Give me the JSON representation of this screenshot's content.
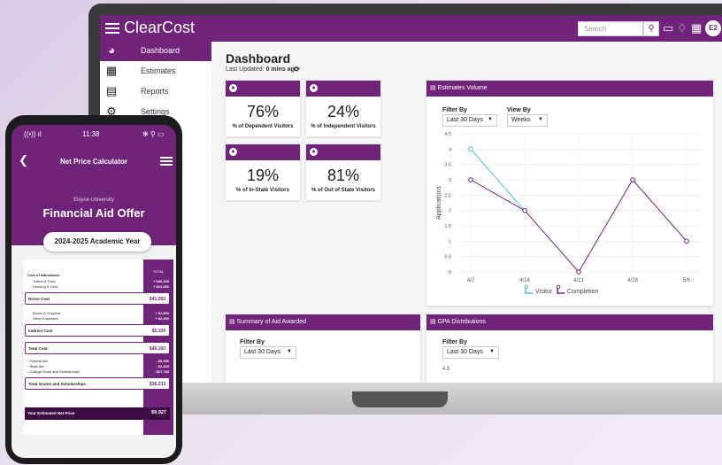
{
  "app": {
    "brand": "ClearCost",
    "search_placeholder": "Search",
    "avatar_initials": "E2"
  },
  "sidebar": {
    "items": [
      {
        "label": "Dashboard",
        "icon": "speedometer-icon",
        "active": true
      },
      {
        "label": "Estimates",
        "icon": "calculator-icon",
        "active": false
      },
      {
        "label": "Reports",
        "icon": "chart-icon",
        "active": false
      },
      {
        "label": "Settings",
        "icon": "gear-icon",
        "active": false
      }
    ]
  },
  "dashboard": {
    "title": "Dashboard",
    "updated_label": "Last Updated:",
    "updated_value": "0 mins ago",
    "stats": [
      {
        "value": "76%",
        "label": "% of Dependent Visitors"
      },
      {
        "value": "24%",
        "label": "% of Independent Visitors"
      },
      {
        "value": "19%",
        "label": "% of In-State Visitors"
      },
      {
        "value": "81%",
        "label": "% of Out of State Visitors"
      }
    ]
  },
  "estimates_volume": {
    "title": "Estimates Volume",
    "filter_label": "Filter By",
    "filter_value": "Last 30 Days",
    "view_label": "View By",
    "view_value": "Weeks"
  },
  "aid_summary": {
    "title": "Summary of Aid Awarded",
    "filter_label": "Filter By",
    "filter_value": "Last 30 Days"
  },
  "gpa": {
    "title": "GPA Distributions",
    "filter_label": "Filter By",
    "filter_value": "Last 30 Days",
    "first_tick": "4.5"
  },
  "chart_data": {
    "type": "line",
    "title": "",
    "xlabel": "",
    "ylabel": "Applications",
    "categories": [
      "4/7",
      "4/14",
      "4/21",
      "4/28",
      "5/5"
    ],
    "ylim": [
      0,
      4.5
    ],
    "yticks": [
      0,
      0.5,
      1,
      1.5,
      2,
      2.5,
      3,
      3.5,
      4,
      4.5
    ],
    "grid": true,
    "legend": "bottom",
    "series": [
      {
        "name": "Visitor",
        "color": "#4fc3d6",
        "values": [
          4,
          2,
          null,
          null,
          null
        ]
      },
      {
        "name": "Completion",
        "color": "#6f2379",
        "values": [
          3,
          2,
          0,
          3,
          1
        ]
      }
    ]
  },
  "phone": {
    "time": "11:38",
    "signal": "((•)) ıl",
    "battery": "✻ ⚲ ▭",
    "title": "Net Price Calculator",
    "university": "Elsyce University",
    "headline": "Financial Aid Offer",
    "academic_year": "2024-2025 Academic Year",
    "total_header": "TOTAL",
    "cost_heading": "Cost of Attendance",
    "cost_items": [
      {
        "label": "Tuition & Fees",
        "amount": "+ $30,230"
      },
      {
        "label": "Housing & Food",
        "amount": "+ $10,830"
      }
    ],
    "direct_label": "Direct Cost",
    "direct_amount": "$41,060",
    "indirect_items": [
      {
        "label": "Books & Supplies",
        "amount": "+ $1,800"
      },
      {
        "label": "Other Expenses",
        "amount": "+ $3,300"
      }
    ],
    "indirect_label": "Indirect Cost",
    "indirect_amount": "$5,100",
    "total_label": "Total Cost",
    "total_amount": "$46,160",
    "aid_items": [
      {
        "label": "Federal Aid",
        "amount": "- $6,095"
      },
      {
        "label": "State Aid",
        "amount": "- $2,400"
      },
      {
        "label": "College Grant and Scholarships",
        "amount": "- $27,738"
      }
    ],
    "grants_label": "Total Grants and Scholarships",
    "grants_amount": "$36,233",
    "net_label": "Your Estimated Net Price",
    "net_amount": "$9,927"
  }
}
